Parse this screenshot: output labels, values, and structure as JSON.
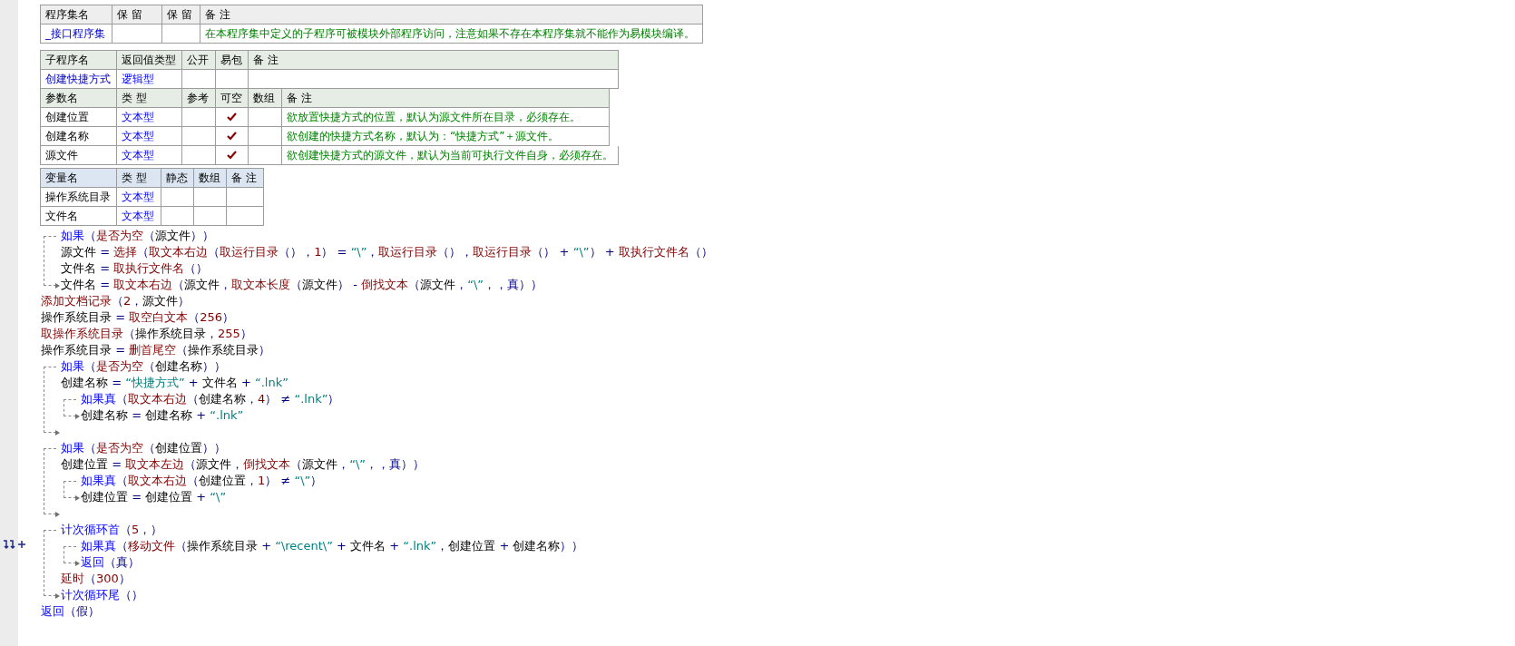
{
  "assembly_table": {
    "columns": [
      "程序集名",
      "保 留",
      "保 留",
      "备 注"
    ],
    "rows": [
      {
        "name": "_接口程序集",
        "note": "在本程序集中定义的子程序可被模块外部程序访问，注意如果不存在本程序集就不能作为易模块编译。"
      }
    ]
  },
  "subroutine_table": {
    "columns": [
      "子程序名",
      "返回值类型",
      "公开",
      "易包",
      "备 注"
    ],
    "name": "创建快捷方式",
    "return_type": "逻辑型",
    "public": false,
    "easy_package": false,
    "param_columns": [
      "参数名",
      "类 型",
      "参考",
      "可空",
      "数组",
      "备 注"
    ],
    "params": [
      {
        "name": "创建位置",
        "type": "文本型",
        "reference": false,
        "optional": true,
        "array": false,
        "note": "欲放置快捷方式的位置，默认为源文件所在目录，必须存在。"
      },
      {
        "name": "创建名称",
        "type": "文本型",
        "reference": false,
        "optional": true,
        "array": false,
        "note": "欲创建的快捷方式名称，默认为：“快捷方式”＋源文件。"
      },
      {
        "name": "源文件",
        "type": "文本型",
        "reference": false,
        "optional": true,
        "array": false,
        "note": "欲创建快捷方式的源文件，默认为当前可执行文件自身，必须存在。"
      }
    ]
  },
  "variable_table": {
    "columns": [
      "变量名",
      "类 型",
      "静态",
      "数组",
      "备 注"
    ],
    "rows": [
      {
        "name": "操作系统目录",
        "type": "文本型",
        "static": false,
        "array": false
      },
      {
        "name": "文件名",
        "type": "文本型",
        "static": false,
        "array": false
      }
    ]
  },
  "code": [
    {
      "kind": "block",
      "tokens": [
        {
          "kind": "kw",
          "text": "如果"
        },
        {
          "kind": "punc",
          "text": "（"
        },
        {
          "kind": "fn",
          "text": "是否为空"
        },
        {
          "kind": "punc",
          "text": "（"
        },
        {
          "kind": "var",
          "text": "源文件"
        },
        {
          "kind": "punc",
          "text": "））"
        }
      ],
      "children": [
        {
          "kind": "line",
          "tokens": [
            {
              "kind": "var",
              "text": "源文件"
            },
            {
              "kind": "op",
              "text": " = "
            },
            {
              "kind": "fn",
              "text": "选择"
            },
            {
              "kind": "punc",
              "text": "（"
            },
            {
              "kind": "fn",
              "text": "取文本右边"
            },
            {
              "kind": "punc",
              "text": "（"
            },
            {
              "kind": "fn",
              "text": "取运行目录"
            },
            {
              "kind": "punc",
              "text": "（），"
            },
            {
              "kind": "num",
              "text": "1"
            },
            {
              "kind": "punc",
              "text": "）"
            },
            {
              "kind": "op",
              "text": " = "
            },
            {
              "kind": "str",
              "text": "“\\”"
            },
            {
              "kind": "punc",
              "text": "，"
            },
            {
              "kind": "fn",
              "text": "取运行目录"
            },
            {
              "kind": "punc",
              "text": "（），"
            },
            {
              "kind": "fn",
              "text": "取运行目录"
            },
            {
              "kind": "punc",
              "text": "（）"
            },
            {
              "kind": "op",
              "text": " + "
            },
            {
              "kind": "str",
              "text": "“\\”"
            },
            {
              "kind": "punc",
              "text": "）"
            },
            {
              "kind": "op",
              "text": " + "
            },
            {
              "kind": "fn",
              "text": "取执行文件名"
            },
            {
              "kind": "punc",
              "text": "（）"
            }
          ]
        },
        {
          "kind": "line",
          "tokens": [
            {
              "kind": "var",
              "text": "文件名"
            },
            {
              "kind": "op",
              "text": " = "
            },
            {
              "kind": "fn",
              "text": "取执行文件名"
            },
            {
              "kind": "punc",
              "text": "（）"
            }
          ]
        },
        {
          "kind": "line",
          "tokens": [
            {
              "kind": "var",
              "text": "文件名"
            },
            {
              "kind": "op",
              "text": " = "
            },
            {
              "kind": "fn",
              "text": "取文本右边"
            },
            {
              "kind": "punc",
              "text": "（"
            },
            {
              "kind": "var",
              "text": "源文件"
            },
            {
              "kind": "punc",
              "text": "，"
            },
            {
              "kind": "fn",
              "text": "取文本长度"
            },
            {
              "kind": "punc",
              "text": "（"
            },
            {
              "kind": "var",
              "text": "源文件"
            },
            {
              "kind": "punc",
              "text": "）"
            },
            {
              "kind": "op",
              "text": " - "
            },
            {
              "kind": "fn",
              "text": "倒找文本"
            },
            {
              "kind": "punc",
              "text": "（"
            },
            {
              "kind": "var",
              "text": "源文件"
            },
            {
              "kind": "punc",
              "text": "，"
            },
            {
              "kind": "str",
              "text": "“\\”"
            },
            {
              "kind": "punc",
              "text": "，，"
            },
            {
              "kind": "const",
              "text": "真"
            },
            {
              "kind": "punc",
              "text": "））"
            }
          ]
        }
      ]
    },
    {
      "kind": "line",
      "tokens": [
        {
          "kind": "fn",
          "text": "添加文档记录"
        },
        {
          "kind": "punc",
          "text": "（"
        },
        {
          "kind": "num",
          "text": "2"
        },
        {
          "kind": "punc",
          "text": "，"
        },
        {
          "kind": "var",
          "text": "源文件"
        },
        {
          "kind": "punc",
          "text": "）"
        }
      ]
    },
    {
      "kind": "line",
      "tokens": [
        {
          "kind": "var",
          "text": "操作系统目录"
        },
        {
          "kind": "op",
          "text": " = "
        },
        {
          "kind": "fn",
          "text": "取空白文本"
        },
        {
          "kind": "punc",
          "text": "（"
        },
        {
          "kind": "num",
          "text": "256"
        },
        {
          "kind": "punc",
          "text": "）"
        }
      ]
    },
    {
      "kind": "line",
      "tokens": [
        {
          "kind": "fn",
          "text": "取操作系统目录"
        },
        {
          "kind": "punc",
          "text": "（"
        },
        {
          "kind": "var",
          "text": "操作系统目录"
        },
        {
          "kind": "punc",
          "text": "，"
        },
        {
          "kind": "num",
          "text": "255"
        },
        {
          "kind": "punc",
          "text": "）"
        }
      ]
    },
    {
      "kind": "line",
      "tokens": [
        {
          "kind": "var",
          "text": "操作系统目录"
        },
        {
          "kind": "op",
          "text": " = "
        },
        {
          "kind": "fn",
          "text": "删首尾空"
        },
        {
          "kind": "punc",
          "text": "（"
        },
        {
          "kind": "var",
          "text": "操作系统目录"
        },
        {
          "kind": "punc",
          "text": "）"
        }
      ]
    },
    {
      "kind": "block",
      "tokens": [
        {
          "kind": "kw",
          "text": "如果"
        },
        {
          "kind": "punc",
          "text": "（"
        },
        {
          "kind": "fn",
          "text": "是否为空"
        },
        {
          "kind": "punc",
          "text": "（"
        },
        {
          "kind": "var",
          "text": "创建名称"
        },
        {
          "kind": "punc",
          "text": "））"
        }
      ],
      "children": [
        {
          "kind": "line",
          "tokens": [
            {
              "kind": "var",
              "text": "创建名称"
            },
            {
              "kind": "op",
              "text": " = "
            },
            {
              "kind": "str",
              "text": "“快捷方式”"
            },
            {
              "kind": "op",
              "text": " + "
            },
            {
              "kind": "var",
              "text": "文件名"
            },
            {
              "kind": "op",
              "text": " + "
            },
            {
              "kind": "str",
              "text": "“.lnk”"
            }
          ]
        },
        {
          "kind": "block",
          "tokens": [
            {
              "kind": "kw",
              "text": "如果真"
            },
            {
              "kind": "punc",
              "text": "（"
            },
            {
              "kind": "fn",
              "text": "取文本右边"
            },
            {
              "kind": "punc",
              "text": "（"
            },
            {
              "kind": "var",
              "text": "创建名称"
            },
            {
              "kind": "punc",
              "text": "，"
            },
            {
              "kind": "num",
              "text": "4"
            },
            {
              "kind": "punc",
              "text": "）"
            },
            {
              "kind": "op",
              "text": " ≠ "
            },
            {
              "kind": "str",
              "text": "“.lnk”"
            },
            {
              "kind": "punc",
              "text": "）"
            }
          ],
          "children": [
            {
              "kind": "line",
              "tokens": [
                {
                  "kind": "var",
                  "text": "创建名称"
                },
                {
                  "kind": "op",
                  "text": " = "
                },
                {
                  "kind": "var",
                  "text": "创建名称"
                },
                {
                  "kind": "op",
                  "text": " + "
                },
                {
                  "kind": "str",
                  "text": "“.lnk”"
                }
              ]
            }
          ]
        },
        {
          "kind": "blank"
        }
      ]
    },
    {
      "kind": "block",
      "tokens": [
        {
          "kind": "kw",
          "text": "如果"
        },
        {
          "kind": "punc",
          "text": "（"
        },
        {
          "kind": "fn",
          "text": "是否为空"
        },
        {
          "kind": "punc",
          "text": "（"
        },
        {
          "kind": "var",
          "text": "创建位置"
        },
        {
          "kind": "punc",
          "text": "））"
        }
      ],
      "children": [
        {
          "kind": "line",
          "tokens": [
            {
              "kind": "var",
              "text": "创建位置"
            },
            {
              "kind": "op",
              "text": " = "
            },
            {
              "kind": "fn",
              "text": "取文本左边"
            },
            {
              "kind": "punc",
              "text": "（"
            },
            {
              "kind": "var",
              "text": "源文件"
            },
            {
              "kind": "punc",
              "text": "，"
            },
            {
              "kind": "fn",
              "text": "倒找文本"
            },
            {
              "kind": "punc",
              "text": "（"
            },
            {
              "kind": "var",
              "text": "源文件"
            },
            {
              "kind": "punc",
              "text": "，"
            },
            {
              "kind": "str",
              "text": "“\\”"
            },
            {
              "kind": "punc",
              "text": "，，"
            },
            {
              "kind": "const",
              "text": "真"
            },
            {
              "kind": "punc",
              "text": "））"
            }
          ]
        },
        {
          "kind": "block",
          "tokens": [
            {
              "kind": "kw",
              "text": "如果真"
            },
            {
              "kind": "punc",
              "text": "（"
            },
            {
              "kind": "fn",
              "text": "取文本右边"
            },
            {
              "kind": "punc",
              "text": "（"
            },
            {
              "kind": "var",
              "text": "创建位置"
            },
            {
              "kind": "punc",
              "text": "，"
            },
            {
              "kind": "num",
              "text": "1"
            },
            {
              "kind": "punc",
              "text": "）"
            },
            {
              "kind": "op",
              "text": " ≠ "
            },
            {
              "kind": "str",
              "text": "“\\”"
            },
            {
              "kind": "punc",
              "text": "）"
            }
          ],
          "children": [
            {
              "kind": "line",
              "tokens": [
                {
                  "kind": "var",
                  "text": "创建位置"
                },
                {
                  "kind": "op",
                  "text": " = "
                },
                {
                  "kind": "var",
                  "text": "创建位置"
                },
                {
                  "kind": "op",
                  "text": " + "
                },
                {
                  "kind": "str",
                  "text": "“\\”"
                }
              ]
            }
          ]
        },
        {
          "kind": "blank"
        }
      ]
    },
    {
      "kind": "block",
      "tokens": [
        {
          "kind": "kw",
          "text": "计次循环首"
        },
        {
          "kind": "punc",
          "text": "（"
        },
        {
          "kind": "num",
          "text": "5"
        },
        {
          "kind": "punc",
          "text": "，）"
        }
      ],
      "children": [
        {
          "kind": "block",
          "tokens": [
            {
              "kind": "kw",
              "text": "如果真"
            },
            {
              "kind": "punc",
              "text": "（"
            },
            {
              "kind": "fn",
              "text": "移动文件"
            },
            {
              "kind": "punc",
              "text": "（"
            },
            {
              "kind": "var",
              "text": "操作系统目录"
            },
            {
              "kind": "op",
              "text": " + "
            },
            {
              "kind": "str",
              "text": "“\\recent\\”"
            },
            {
              "kind": "op",
              "text": " + "
            },
            {
              "kind": "var",
              "text": "文件名"
            },
            {
              "kind": "op",
              "text": " + "
            },
            {
              "kind": "str",
              "text": "“.lnk”"
            },
            {
              "kind": "punc",
              "text": "，"
            },
            {
              "kind": "var",
              "text": "创建位置"
            },
            {
              "kind": "op",
              "text": " + "
            },
            {
              "kind": "var",
              "text": "创建名称"
            },
            {
              "kind": "punc",
              "text": "））"
            }
          ],
          "children": [
            {
              "kind": "line",
              "tokens": [
                {
                  "kind": "kw",
                  "text": "返回"
                },
                {
                  "kind": "punc",
                  "text": "（"
                },
                {
                  "kind": "const",
                  "text": "真"
                },
                {
                  "kind": "punc",
                  "text": "）"
                }
              ]
            }
          ]
        },
        {
          "kind": "line",
          "tokens": [
            {
              "kind": "fn",
              "text": "延时"
            },
            {
              "kind": "punc",
              "text": "（"
            },
            {
              "kind": "num",
              "text": "300"
            },
            {
              "kind": "punc",
              "text": "）"
            }
          ]
        },
        {
          "kind": "line",
          "tokens": [
            {
              "kind": "kw",
              "text": "计次循环尾"
            },
            {
              "kind": "punc",
              "text": "（）"
            }
          ]
        }
      ]
    },
    {
      "kind": "line",
      "tokens": [
        {
          "kind": "kw",
          "text": "返回"
        },
        {
          "kind": "punc",
          "text": "（"
        },
        {
          "kind": "const",
          "text": "假"
        },
        {
          "kind": "punc",
          "text": "）"
        }
      ]
    }
  ]
}
